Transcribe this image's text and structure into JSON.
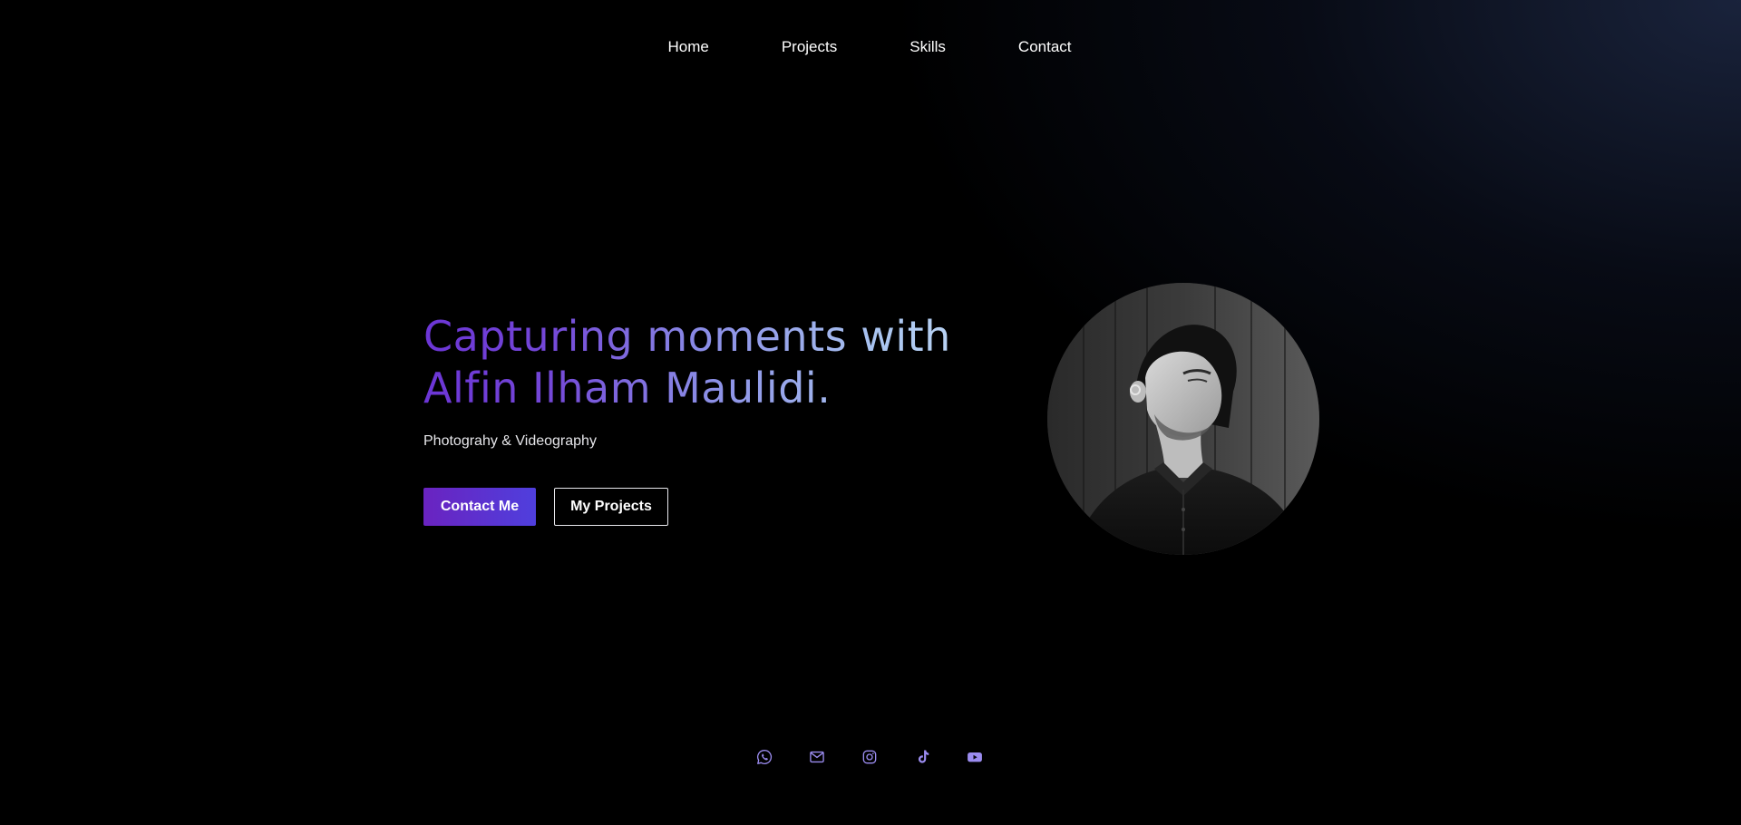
{
  "nav": {
    "items": [
      {
        "label": "Home"
      },
      {
        "label": "Projects"
      },
      {
        "label": "Skills"
      },
      {
        "label": "Contact"
      }
    ]
  },
  "hero": {
    "headline_line1": "Capturing moments with",
    "headline_line2": "Alfin Ilham Maulidi.",
    "subtitle": "Photograhy & Videography",
    "primary_button": "Contact Me",
    "secondary_button": "My Projects"
  },
  "portrait": {
    "alt": "Black and white portrait photo"
  },
  "social": {
    "icons": [
      "whatsapp-icon",
      "mail-icon",
      "instagram-icon",
      "tiktok-icon",
      "youtube-icon"
    ]
  },
  "colors": {
    "background": "#000000",
    "accent_purple": "#6a23c0",
    "accent_blue": "#4f3fdd",
    "icon_color": "#9b8cf0",
    "headline_gradient_start": "#6c35d6",
    "headline_gradient_end": "#c3dcf5"
  }
}
